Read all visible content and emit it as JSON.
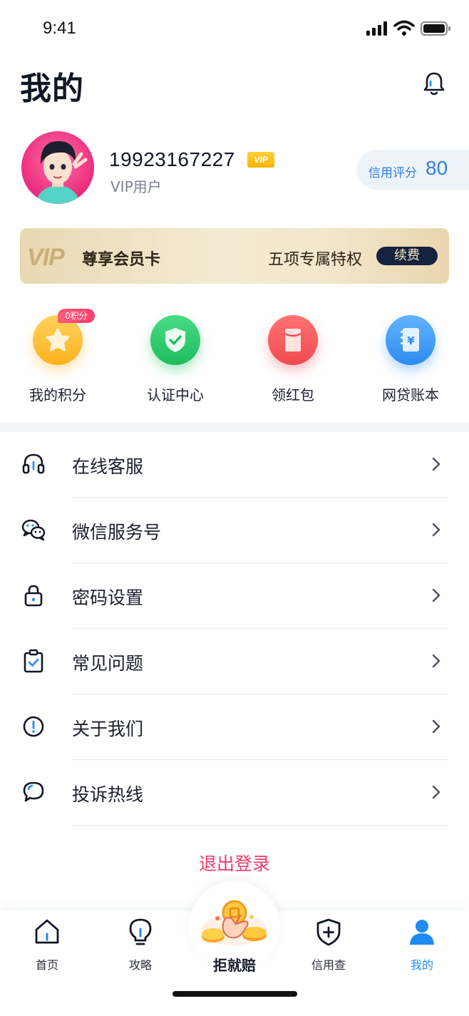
{
  "status_bar": {
    "time": "9:41"
  },
  "header": {
    "title": "我的",
    "bell_icon": "bell-icon"
  },
  "profile": {
    "phone": "19923167227",
    "vip_badge": "VIP",
    "level": "VIP用户",
    "credit_label": "信用评分",
    "credit_score": "80"
  },
  "vip_card": {
    "logo": "VIP",
    "name": "尊享会员卡",
    "desc": "五项专属特权",
    "renew_label": "续费"
  },
  "quick_actions": [
    {
      "label": "我的积分",
      "icon": "star-icon",
      "color": "#ffc23d",
      "badge": "0积分"
    },
    {
      "label": "认证中心",
      "icon": "shield-check-icon",
      "color": "#2ecb6e"
    },
    {
      "label": "领红包",
      "icon": "red-envelope-icon",
      "color": "#f6555b"
    },
    {
      "label": "网贷账本",
      "icon": "ledger-icon",
      "color": "#3d9bf3"
    }
  ],
  "menu": [
    {
      "label": "在线客服",
      "icon": "headset-icon"
    },
    {
      "label": "微信服务号",
      "icon": "wechat-icon"
    },
    {
      "label": "密码设置",
      "icon": "lock-icon"
    },
    {
      "label": "常见问题",
      "icon": "clipboard-check-icon"
    },
    {
      "label": "关于我们",
      "icon": "info-icon"
    },
    {
      "label": "投诉热线",
      "icon": "chat-bubble-icon"
    }
  ],
  "logout_label": "退出登录",
  "tabbar": {
    "items": [
      {
        "label": "首页",
        "icon": "home-icon"
      },
      {
        "label": "攻略",
        "icon": "lightbulb-icon"
      },
      {
        "label": "拒就赔",
        "icon": "coin-hand-icon"
      },
      {
        "label": "信用查",
        "icon": "shield-plus-icon"
      },
      {
        "label": "我的",
        "icon": "user-icon",
        "active": true
      }
    ],
    "active_color": "#1e8cf0"
  },
  "colors": {
    "accent": "#1e8cf0",
    "logout": "#ee3b6a",
    "dark": "#121726"
  }
}
